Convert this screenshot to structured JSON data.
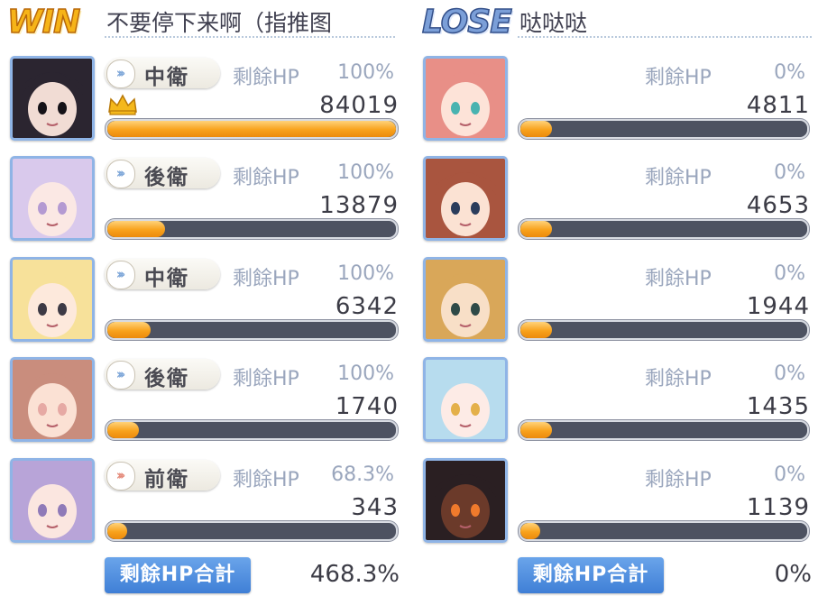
{
  "win_side": {
    "result_label": "WIN",
    "player_name": "不要停下来啊（指推图",
    "units": [
      {
        "position": "中衛",
        "chevron": "blue",
        "hp_label": "剩餘HP",
        "hp_percent": "100%",
        "damage": "84019",
        "bar_fill": 1.0,
        "top_damage": true,
        "portrait_colors": [
          "#2b2530",
          "#f1dcd4",
          "#151218"
        ]
      },
      {
        "position": "後衛",
        "chevron": "blue",
        "hp_label": "剩餘HP",
        "hp_percent": "100%",
        "damage": "13879",
        "bar_fill": 0.2,
        "top_damage": false,
        "portrait_colors": [
          "#d9c9ec",
          "#fbe8e4",
          "#b49ad2"
        ]
      },
      {
        "position": "中衛",
        "chevron": "blue",
        "hp_label": "剩餘HP",
        "hp_percent": "100%",
        "damage": "6342",
        "bar_fill": 0.15,
        "top_damage": false,
        "portrait_colors": [
          "#f7e19a",
          "#fde9dc",
          "#3d3a45"
        ]
      },
      {
        "position": "後衛",
        "chevron": "blue",
        "hp_label": "剩餘HP",
        "hp_percent": "100%",
        "damage": "1740",
        "bar_fill": 0.11,
        "top_damage": false,
        "portrait_colors": [
          "#c98d7d",
          "#fbe1d4",
          "#e6a9a4"
        ]
      },
      {
        "position": "前衛",
        "chevron": "red",
        "hp_label": "剩餘HP",
        "hp_percent": "68.3%",
        "damage": "343",
        "bar_fill": 0.07,
        "top_damage": false,
        "portrait_colors": [
          "#b8a4d8",
          "#fbe6e0",
          "#8f7ab8"
        ]
      }
    ],
    "total_label": "剩餘HP合計",
    "total_value": "468.3%"
  },
  "lose_side": {
    "result_label": "LOSE",
    "player_name": "哒哒哒",
    "units": [
      {
        "hp_label": "剩餘HP",
        "hp_percent": "0%",
        "damage": "4811",
        "bar_fill": 0.11,
        "portrait_colors": [
          "#e88f87",
          "#fde3d8",
          "#49b3b0"
        ]
      },
      {
        "hp_label": "剩餘HP",
        "hp_percent": "0%",
        "damage": "4653",
        "bar_fill": 0.11,
        "portrait_colors": [
          "#a9553f",
          "#fbe2d3",
          "#2b3d5c"
        ]
      },
      {
        "hp_label": "剩餘HP",
        "hp_percent": "0%",
        "damage": "1944",
        "bar_fill": 0.11,
        "portrait_colors": [
          "#d9a759",
          "#f8dfc7",
          "#2f4a47"
        ]
      },
      {
        "hp_label": "剩餘HP",
        "hp_percent": "0%",
        "damage": "1435",
        "bar_fill": 0.11,
        "portrait_colors": [
          "#b7dcee",
          "#fdebe6",
          "#e4b04a"
        ]
      },
      {
        "hp_label": "剩餘HP",
        "hp_percent": "0%",
        "damage": "1139",
        "bar_fill": 0.07,
        "portrait_colors": [
          "#2a1f22",
          "#6b3a2a",
          "#f07a2c"
        ]
      }
    ],
    "total_label": "剩餘HP合計",
    "total_value": "0%"
  }
}
